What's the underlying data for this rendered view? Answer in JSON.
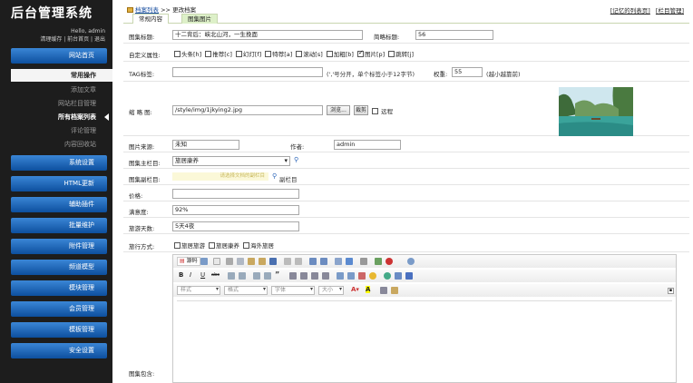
{
  "sidebar": {
    "logo": "后台管理系统",
    "hello": "Hello, admin",
    "links": "清理缓存 | 前台首页 | 退出",
    "top_nav": "网站首页",
    "section": "常用操作",
    "sub_items": [
      "添加文章",
      "网站栏目管理",
      "所有档案列表",
      "评论管理",
      "内容回收站"
    ],
    "nav": [
      "系统设置",
      "HTML更新",
      "辅助插件",
      "批量维护",
      "附件管理",
      "频道模型",
      "模块管理",
      "会员管理",
      "模板管理",
      "安全设置"
    ]
  },
  "header": {
    "crumb_link": "档案列表",
    "crumb_sep": ">>",
    "crumb_current": "更改档案",
    "link_recent": "[记忆的列表页]",
    "link_column": "[栏目管理]"
  },
  "tabs": [
    "常规内容",
    "图集图片"
  ],
  "form": {
    "title_label": "图集标题:",
    "title_value": "十二背后：峡北山河，一生挽面",
    "short_title_label": "简略标题:",
    "short_title_value": "56",
    "attr_label": "自定义属性:",
    "attrs": [
      "头条[h]",
      "推荐[c]",
      "幻灯[f]",
      "特荐[a]",
      "滚动[s]",
      "加粗[b]",
      "图片[p]",
      "跳转[j]"
    ],
    "attr_checked_index": 6,
    "tag_label": "TAG标签:",
    "tag_hint": "(','号分开，单个标签小于12字节)",
    "weight_label": "权重:",
    "weight_value": "55",
    "weight_hint": "(越小越靠前)",
    "thumb_label": "缩 略 图:",
    "thumb_value": "/style/img/1jkying2.jpg",
    "browse_btn": "浏览...",
    "crop_btn": "裁剪",
    "remote_label": "远程",
    "source_label": "图片来源:",
    "source_value": "未知",
    "author_label": "作者:",
    "author_value": "admin",
    "main_col_label": "图集主栏目:",
    "main_col_value": "旅居康养",
    "sub_col_label": "图集副栏目:",
    "sub_col_hint": "请选择文档的副栏目",
    "sub_col_link": "副栏目",
    "price_label": "价格:",
    "price_value": "",
    "satisfaction_label": "满意度:",
    "satisfaction_value": "92%",
    "days_label": "旅游天数:",
    "days_value": "5天4夜",
    "mode_label": "旅行方式:",
    "modes": [
      "旅居旅游",
      "旅居康养",
      "海外旅居"
    ],
    "content_label": "图集包含:"
  },
  "editor": {
    "source_btn": "源码",
    "style_placeholder": "样式",
    "format_placeholder": "格式",
    "font_placeholder": "字体",
    "size_placeholder": "大小"
  }
}
